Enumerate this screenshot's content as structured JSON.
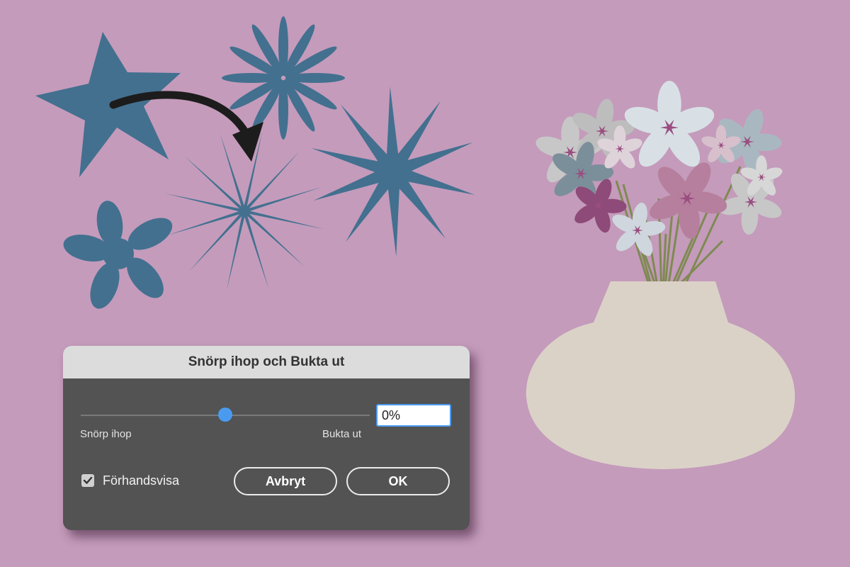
{
  "colors": {
    "background": "#c49bbb",
    "shape_blue": "#43708f",
    "vase": "#dbd2c7",
    "dialog_body": "#535353",
    "dialog_title_bar": "#dcdcdc",
    "accent_blue": "#4a9bf0"
  },
  "illustration": {
    "left_shapes": [
      "star-shape",
      "flower-star-shape",
      "spiky-star-shape",
      "thin-burst-shape",
      "blob-flower-shape"
    ],
    "arrow": "curved-arrow-icon",
    "bouquet": "flower-bouquet",
    "vase": "vase"
  },
  "dialog": {
    "title": "Snörp ihop och Bukta ut",
    "slider": {
      "value_percent": 0,
      "min_percent": -200,
      "max_percent": 200,
      "input_value": "0%",
      "left_label": "Snörp ihop",
      "right_label": "Bukta ut"
    },
    "preview": {
      "label": "Förhandsvisa",
      "checked": true,
      "icon": "checkmark-icon"
    },
    "buttons": {
      "cancel": "Avbryt",
      "ok": "OK"
    }
  }
}
